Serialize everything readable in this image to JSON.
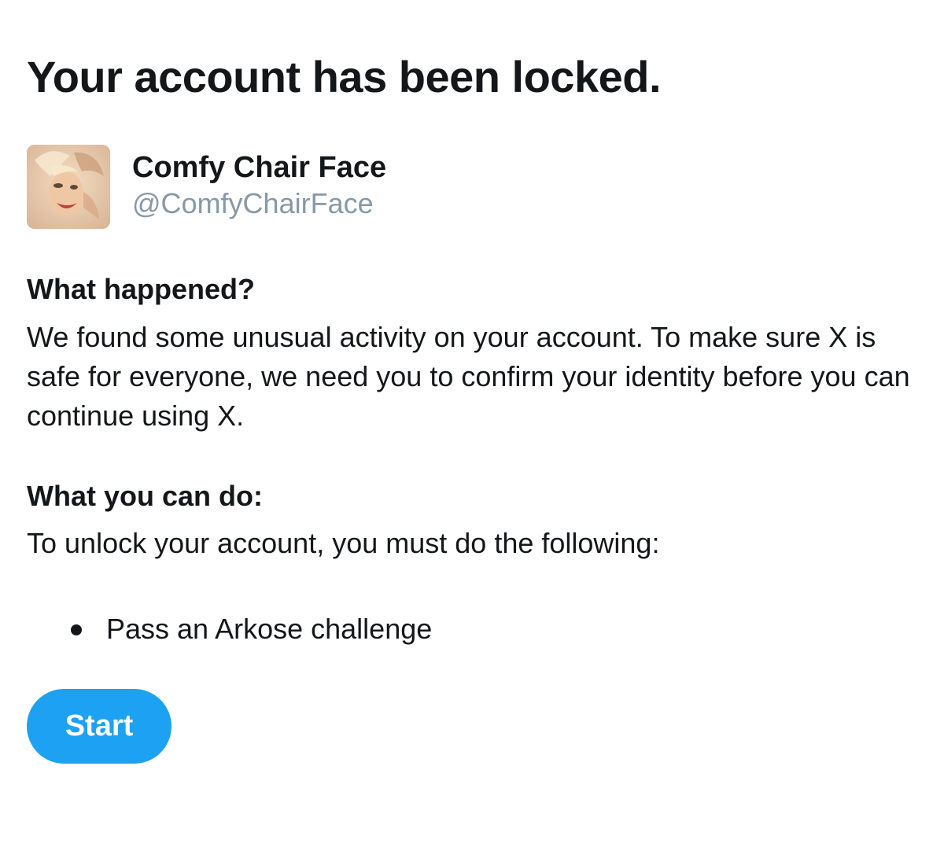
{
  "page": {
    "title": "Your account has been locked."
  },
  "account": {
    "display_name": "Comfy Chair Face",
    "handle": "@ComfyChairFace",
    "avatar_icon": "avatar-photo-icon"
  },
  "what_happened": {
    "heading": "What happened?",
    "body": "We found some unusual activity on your account. To make sure X is safe for everyone, we need you to confirm your identity before you can continue using X."
  },
  "what_you_can_do": {
    "heading": "What you can do:",
    "body": "To unlock your account, you must do the following:",
    "steps": [
      {
        "label": "Pass an Arkose challenge"
      }
    ]
  },
  "actions": {
    "start_label": "Start"
  },
  "colors": {
    "primary_text": "#14171a",
    "secondary_text": "#8899a6",
    "accent": "#1da1f2",
    "button_text": "#ffffff",
    "background": "#ffffff"
  }
}
